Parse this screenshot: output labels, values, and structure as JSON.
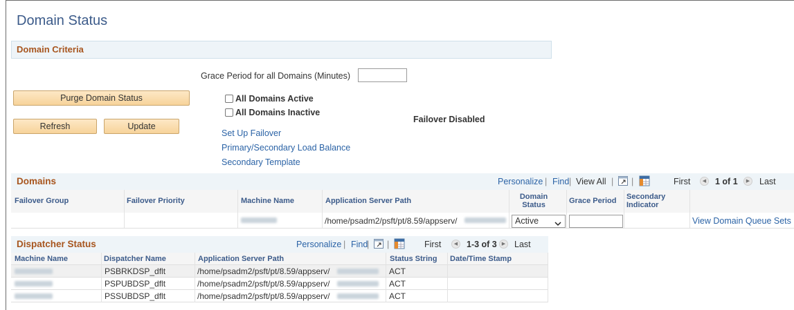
{
  "page": {
    "title": "Domain Status"
  },
  "criteria": {
    "section_label": "Domain Criteria",
    "grace_label": "Grace Period for all Domains (Minutes)",
    "grace_value": "",
    "purge_button": "Purge Domain Status",
    "refresh_button": "Refresh",
    "update_button": "Update",
    "all_active_label": "All Domains Active",
    "all_inactive_label": "All Domains Inactive",
    "failover_status": "Failover Disabled",
    "links": [
      "Set Up Failover",
      "Primary/Secondary Load Balance",
      "Secondary Template"
    ]
  },
  "domains": {
    "title": "Domains",
    "personalize": "Personalize",
    "find": "Find",
    "view_all": "View All",
    "first": "First",
    "range": "1 of 1",
    "last": "Last",
    "columns": [
      "Failover Group",
      "Failover Priority",
      "Machine Name",
      "Application Server Path",
      "Domain Status",
      "Grace Period",
      "Secondary Indicator"
    ],
    "row": {
      "path": "/home/psadm2/psft/pt/8.59/appserv/",
      "status": "Active",
      "link": "View Domain Queue Sets"
    }
  },
  "dispatcher": {
    "title": "Dispatcher Status",
    "personalize": "Personalize",
    "find": "Find",
    "first": "First",
    "range": "1-3 of 3",
    "last": "Last",
    "columns": [
      "Machine Name",
      "Dispatcher Name",
      "Application Server Path",
      "Status String",
      "Date/Time Stamp"
    ],
    "rows": [
      {
        "name": "PSBRKDSP_dflt",
        "path": "/home/psadm2/psft/pt/8.59/appserv/",
        "status": "ACT"
      },
      {
        "name": "PSPUBDSP_dflt",
        "path": "/home/psadm2/psft/pt/8.59/appserv/",
        "status": "ACT"
      },
      {
        "name": "PSSUBDSP_dflt",
        "path": "/home/psadm2/psft/pt/8.59/appserv/",
        "status": "ACT"
      }
    ]
  },
  "colors": {
    "accent": "#a7551e",
    "link": "#2b63a6",
    "title": "#3c5b8a",
    "button": "#f7d49a"
  },
  "icons": [
    "zoom-grid-icon",
    "download-grid-icon",
    "prev-icon",
    "next-icon",
    "dropdown-icon"
  ]
}
